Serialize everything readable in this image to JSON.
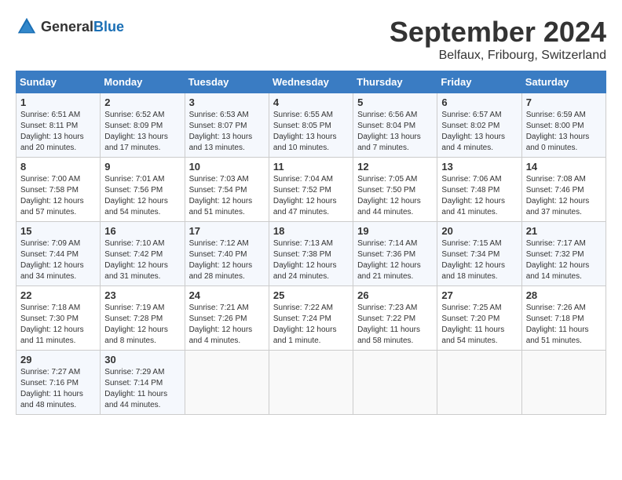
{
  "header": {
    "logo_general": "General",
    "logo_blue": "Blue",
    "month_title": "September 2024",
    "location": "Belfaux, Fribourg, Switzerland"
  },
  "weekdays": [
    "Sunday",
    "Monday",
    "Tuesday",
    "Wednesday",
    "Thursday",
    "Friday",
    "Saturday"
  ],
  "weeks": [
    [
      {
        "day": "1",
        "sunrise": "Sunrise: 6:51 AM",
        "sunset": "Sunset: 8:11 PM",
        "daylight": "Daylight: 13 hours and 20 minutes."
      },
      {
        "day": "2",
        "sunrise": "Sunrise: 6:52 AM",
        "sunset": "Sunset: 8:09 PM",
        "daylight": "Daylight: 13 hours and 17 minutes."
      },
      {
        "day": "3",
        "sunrise": "Sunrise: 6:53 AM",
        "sunset": "Sunset: 8:07 PM",
        "daylight": "Daylight: 13 hours and 13 minutes."
      },
      {
        "day": "4",
        "sunrise": "Sunrise: 6:55 AM",
        "sunset": "Sunset: 8:05 PM",
        "daylight": "Daylight: 13 hours and 10 minutes."
      },
      {
        "day": "5",
        "sunrise": "Sunrise: 6:56 AM",
        "sunset": "Sunset: 8:04 PM",
        "daylight": "Daylight: 13 hours and 7 minutes."
      },
      {
        "day": "6",
        "sunrise": "Sunrise: 6:57 AM",
        "sunset": "Sunset: 8:02 PM",
        "daylight": "Daylight: 13 hours and 4 minutes."
      },
      {
        "day": "7",
        "sunrise": "Sunrise: 6:59 AM",
        "sunset": "Sunset: 8:00 PM",
        "daylight": "Daylight: 13 hours and 0 minutes."
      }
    ],
    [
      {
        "day": "8",
        "sunrise": "Sunrise: 7:00 AM",
        "sunset": "Sunset: 7:58 PM",
        "daylight": "Daylight: 12 hours and 57 minutes."
      },
      {
        "day": "9",
        "sunrise": "Sunrise: 7:01 AM",
        "sunset": "Sunset: 7:56 PM",
        "daylight": "Daylight: 12 hours and 54 minutes."
      },
      {
        "day": "10",
        "sunrise": "Sunrise: 7:03 AM",
        "sunset": "Sunset: 7:54 PM",
        "daylight": "Daylight: 12 hours and 51 minutes."
      },
      {
        "day": "11",
        "sunrise": "Sunrise: 7:04 AM",
        "sunset": "Sunset: 7:52 PM",
        "daylight": "Daylight: 12 hours and 47 minutes."
      },
      {
        "day": "12",
        "sunrise": "Sunrise: 7:05 AM",
        "sunset": "Sunset: 7:50 PM",
        "daylight": "Daylight: 12 hours and 44 minutes."
      },
      {
        "day": "13",
        "sunrise": "Sunrise: 7:06 AM",
        "sunset": "Sunset: 7:48 PM",
        "daylight": "Daylight: 12 hours and 41 minutes."
      },
      {
        "day": "14",
        "sunrise": "Sunrise: 7:08 AM",
        "sunset": "Sunset: 7:46 PM",
        "daylight": "Daylight: 12 hours and 37 minutes."
      }
    ],
    [
      {
        "day": "15",
        "sunrise": "Sunrise: 7:09 AM",
        "sunset": "Sunset: 7:44 PM",
        "daylight": "Daylight: 12 hours and 34 minutes."
      },
      {
        "day": "16",
        "sunrise": "Sunrise: 7:10 AM",
        "sunset": "Sunset: 7:42 PM",
        "daylight": "Daylight: 12 hours and 31 minutes."
      },
      {
        "day": "17",
        "sunrise": "Sunrise: 7:12 AM",
        "sunset": "Sunset: 7:40 PM",
        "daylight": "Daylight: 12 hours and 28 minutes."
      },
      {
        "day": "18",
        "sunrise": "Sunrise: 7:13 AM",
        "sunset": "Sunset: 7:38 PM",
        "daylight": "Daylight: 12 hours and 24 minutes."
      },
      {
        "day": "19",
        "sunrise": "Sunrise: 7:14 AM",
        "sunset": "Sunset: 7:36 PM",
        "daylight": "Daylight: 12 hours and 21 minutes."
      },
      {
        "day": "20",
        "sunrise": "Sunrise: 7:15 AM",
        "sunset": "Sunset: 7:34 PM",
        "daylight": "Daylight: 12 hours and 18 minutes."
      },
      {
        "day": "21",
        "sunrise": "Sunrise: 7:17 AM",
        "sunset": "Sunset: 7:32 PM",
        "daylight": "Daylight: 12 hours and 14 minutes."
      }
    ],
    [
      {
        "day": "22",
        "sunrise": "Sunrise: 7:18 AM",
        "sunset": "Sunset: 7:30 PM",
        "daylight": "Daylight: 12 hours and 11 minutes."
      },
      {
        "day": "23",
        "sunrise": "Sunrise: 7:19 AM",
        "sunset": "Sunset: 7:28 PM",
        "daylight": "Daylight: 12 hours and 8 minutes."
      },
      {
        "day": "24",
        "sunrise": "Sunrise: 7:21 AM",
        "sunset": "Sunset: 7:26 PM",
        "daylight": "Daylight: 12 hours and 4 minutes."
      },
      {
        "day": "25",
        "sunrise": "Sunrise: 7:22 AM",
        "sunset": "Sunset: 7:24 PM",
        "daylight": "Daylight: 12 hours and 1 minute."
      },
      {
        "day": "26",
        "sunrise": "Sunrise: 7:23 AM",
        "sunset": "Sunset: 7:22 PM",
        "daylight": "Daylight: 11 hours and 58 minutes."
      },
      {
        "day": "27",
        "sunrise": "Sunrise: 7:25 AM",
        "sunset": "Sunset: 7:20 PM",
        "daylight": "Daylight: 11 hours and 54 minutes."
      },
      {
        "day": "28",
        "sunrise": "Sunrise: 7:26 AM",
        "sunset": "Sunset: 7:18 PM",
        "daylight": "Daylight: 11 hours and 51 minutes."
      }
    ],
    [
      {
        "day": "29",
        "sunrise": "Sunrise: 7:27 AM",
        "sunset": "Sunset: 7:16 PM",
        "daylight": "Daylight: 11 hours and 48 minutes."
      },
      {
        "day": "30",
        "sunrise": "Sunrise: 7:29 AM",
        "sunset": "Sunset: 7:14 PM",
        "daylight": "Daylight: 11 hours and 44 minutes."
      },
      {
        "day": "",
        "sunrise": "",
        "sunset": "",
        "daylight": ""
      },
      {
        "day": "",
        "sunrise": "",
        "sunset": "",
        "daylight": ""
      },
      {
        "day": "",
        "sunrise": "",
        "sunset": "",
        "daylight": ""
      },
      {
        "day": "",
        "sunrise": "",
        "sunset": "",
        "daylight": ""
      },
      {
        "day": "",
        "sunrise": "",
        "sunset": "",
        "daylight": ""
      }
    ]
  ]
}
